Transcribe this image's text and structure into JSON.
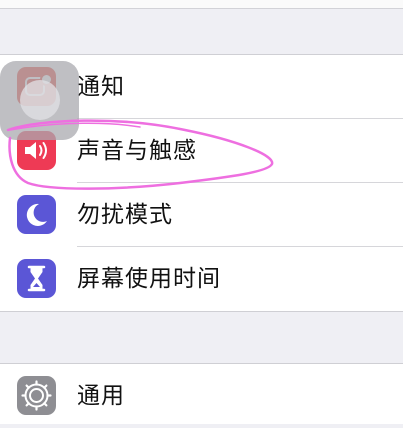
{
  "settings": {
    "items": [
      {
        "label": "通知",
        "icon": "notifications-icon",
        "color": "#e9443a"
      },
      {
        "label": "声音与触感",
        "icon": "speaker-icon",
        "color": "#ee3a55"
      },
      {
        "label": "勿扰模式",
        "icon": "moon-icon",
        "color": "#5b56d6"
      },
      {
        "label": "屏幕使用时间",
        "icon": "hourglass-icon",
        "color": "#5b56d6"
      }
    ],
    "items2": [
      {
        "label": "通用",
        "icon": "gear-icon",
        "color": "#8e8e93"
      }
    ]
  },
  "colors": {
    "background": "#efeff4",
    "annotation": "#ee6fe0"
  }
}
